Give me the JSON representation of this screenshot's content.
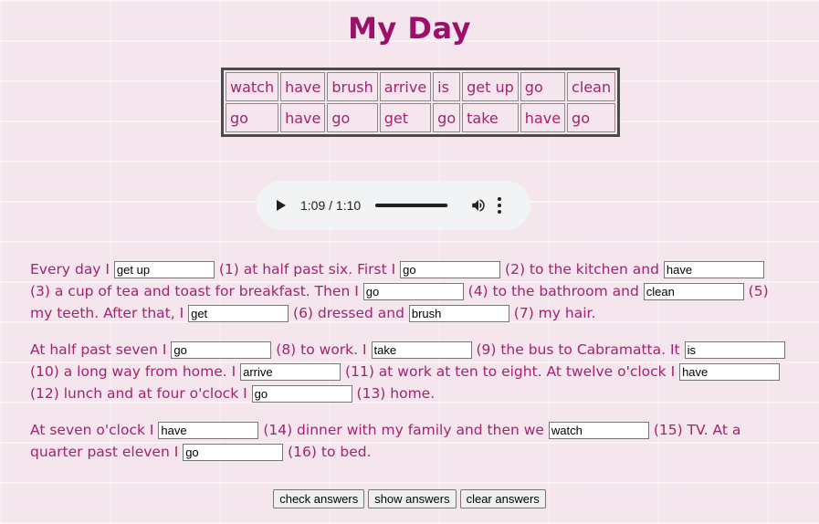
{
  "title": "My Day",
  "word_bank": [
    [
      "watch",
      "have",
      "brush",
      "arrive",
      "is",
      "get up",
      "go",
      "clean"
    ],
    [
      "go",
      "have",
      "go",
      "get",
      "go",
      "take",
      "have",
      "go"
    ]
  ],
  "audio": {
    "time": "1:09 / 1:10",
    "progress": 0.986
  },
  "paragraphs": [
    [
      {
        "t": "text",
        "v": "Every day I "
      },
      {
        "t": "input",
        "v": "get up"
      },
      {
        "t": "text",
        "v": " (1) at half past six. First I "
      },
      {
        "t": "input",
        "v": "go"
      },
      {
        "t": "text",
        "v": " (2) to the kitchen and "
      },
      {
        "t": "input",
        "v": "have"
      },
      {
        "t": "text",
        "v": " (3) a cup of tea and toast for breakfast. Then I "
      },
      {
        "t": "input",
        "v": "go"
      },
      {
        "t": "text",
        "v": " (4) to the bathroom and "
      },
      {
        "t": "input",
        "v": "clean"
      },
      {
        "t": "text",
        "v": " (5) my teeth. After that, I "
      },
      {
        "t": "input",
        "v": "get"
      },
      {
        "t": "text",
        "v": " (6) dressed and "
      },
      {
        "t": "input",
        "v": "brush"
      },
      {
        "t": "text",
        "v": " (7) my hair."
      }
    ],
    [
      {
        "t": "text",
        "v": "At half past seven I "
      },
      {
        "t": "input",
        "v": "go"
      },
      {
        "t": "text",
        "v": " (8) to work. I "
      },
      {
        "t": "input",
        "v": "take"
      },
      {
        "t": "text",
        "v": " (9) the bus to Cabramatta. It "
      },
      {
        "t": "input",
        "v": "is"
      },
      {
        "t": "text",
        "v": " (10) a long way from home. I "
      },
      {
        "t": "input",
        "v": "arrive"
      },
      {
        "t": "text",
        "v": " (11) at work at ten to eight. At twelve o'clock I "
      },
      {
        "t": "input",
        "v": "have"
      },
      {
        "t": "text",
        "v": " (12) lunch and at four o'clock I "
      },
      {
        "t": "input",
        "v": "go"
      },
      {
        "t": "text",
        "v": " (13) home."
      }
    ],
    [
      {
        "t": "text",
        "v": "At seven o'clock I "
      },
      {
        "t": "input",
        "v": "have"
      },
      {
        "t": "text",
        "v": " (14) dinner with my family and then we "
      },
      {
        "t": "input",
        "v": "watch"
      },
      {
        "t": "text",
        "v": " (15) TV. At a quarter past eleven I "
      },
      {
        "t": "input",
        "v": "go"
      },
      {
        "t": "text",
        "v": " (16) to bed."
      }
    ]
  ],
  "buttons": {
    "check": "check answers",
    "show": "show answers",
    "clear": "clear answers"
  }
}
